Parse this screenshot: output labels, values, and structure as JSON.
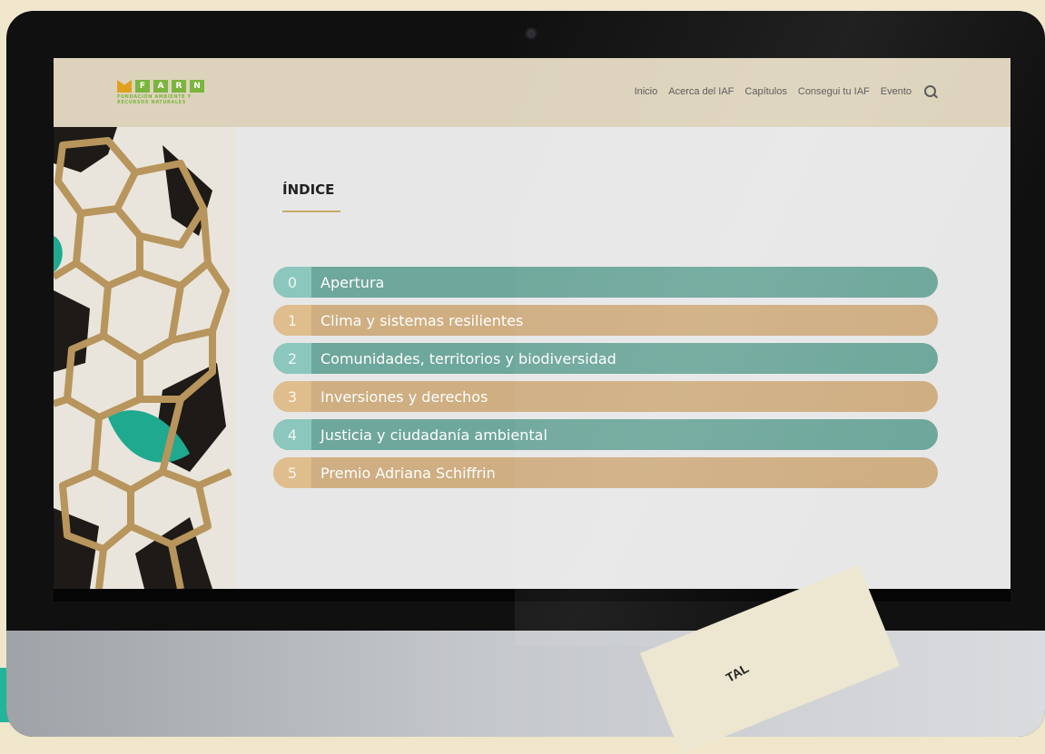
{
  "brand": {
    "logo_letters": [
      "F",
      "A",
      "R",
      "N"
    ],
    "logo_sub": "FUNDACIÓN AMBIENTE Y RECURSOS NATURALES"
  },
  "nav": {
    "items": [
      "Inicio",
      "Acerca del IAF",
      "Capítulos",
      "Consegui tu IAF",
      "Evento"
    ]
  },
  "page": {
    "title": "ÍNDICE"
  },
  "index": [
    {
      "num": "0",
      "label": "Apertura",
      "color": "teal"
    },
    {
      "num": "1",
      "label": "Clima y sistemas resilientes",
      "color": "tan"
    },
    {
      "num": "2",
      "label": "Comunidades, territorios y biodiversidad",
      "color": "teal"
    },
    {
      "num": "3",
      "label": "Inversiones y derechos",
      "color": "tan"
    },
    {
      "num": "4",
      "label": "Justicia y ciudadanía ambiental",
      "color": "teal"
    },
    {
      "num": "5",
      "label": "Premio Adriana Schiffrin",
      "color": "tan"
    }
  ],
  "paper_text": "TAL",
  "colors": {
    "teal": "#6ea79b",
    "teal_light": "#8bc7bc",
    "tan": "#cfae82",
    "tan_light": "#e0bd8d",
    "header_bg": "#ddd3bc",
    "logo_green": "#7bb53d"
  },
  "icons": {
    "search": "search-icon",
    "logo_leaf": "leaf-icon"
  }
}
